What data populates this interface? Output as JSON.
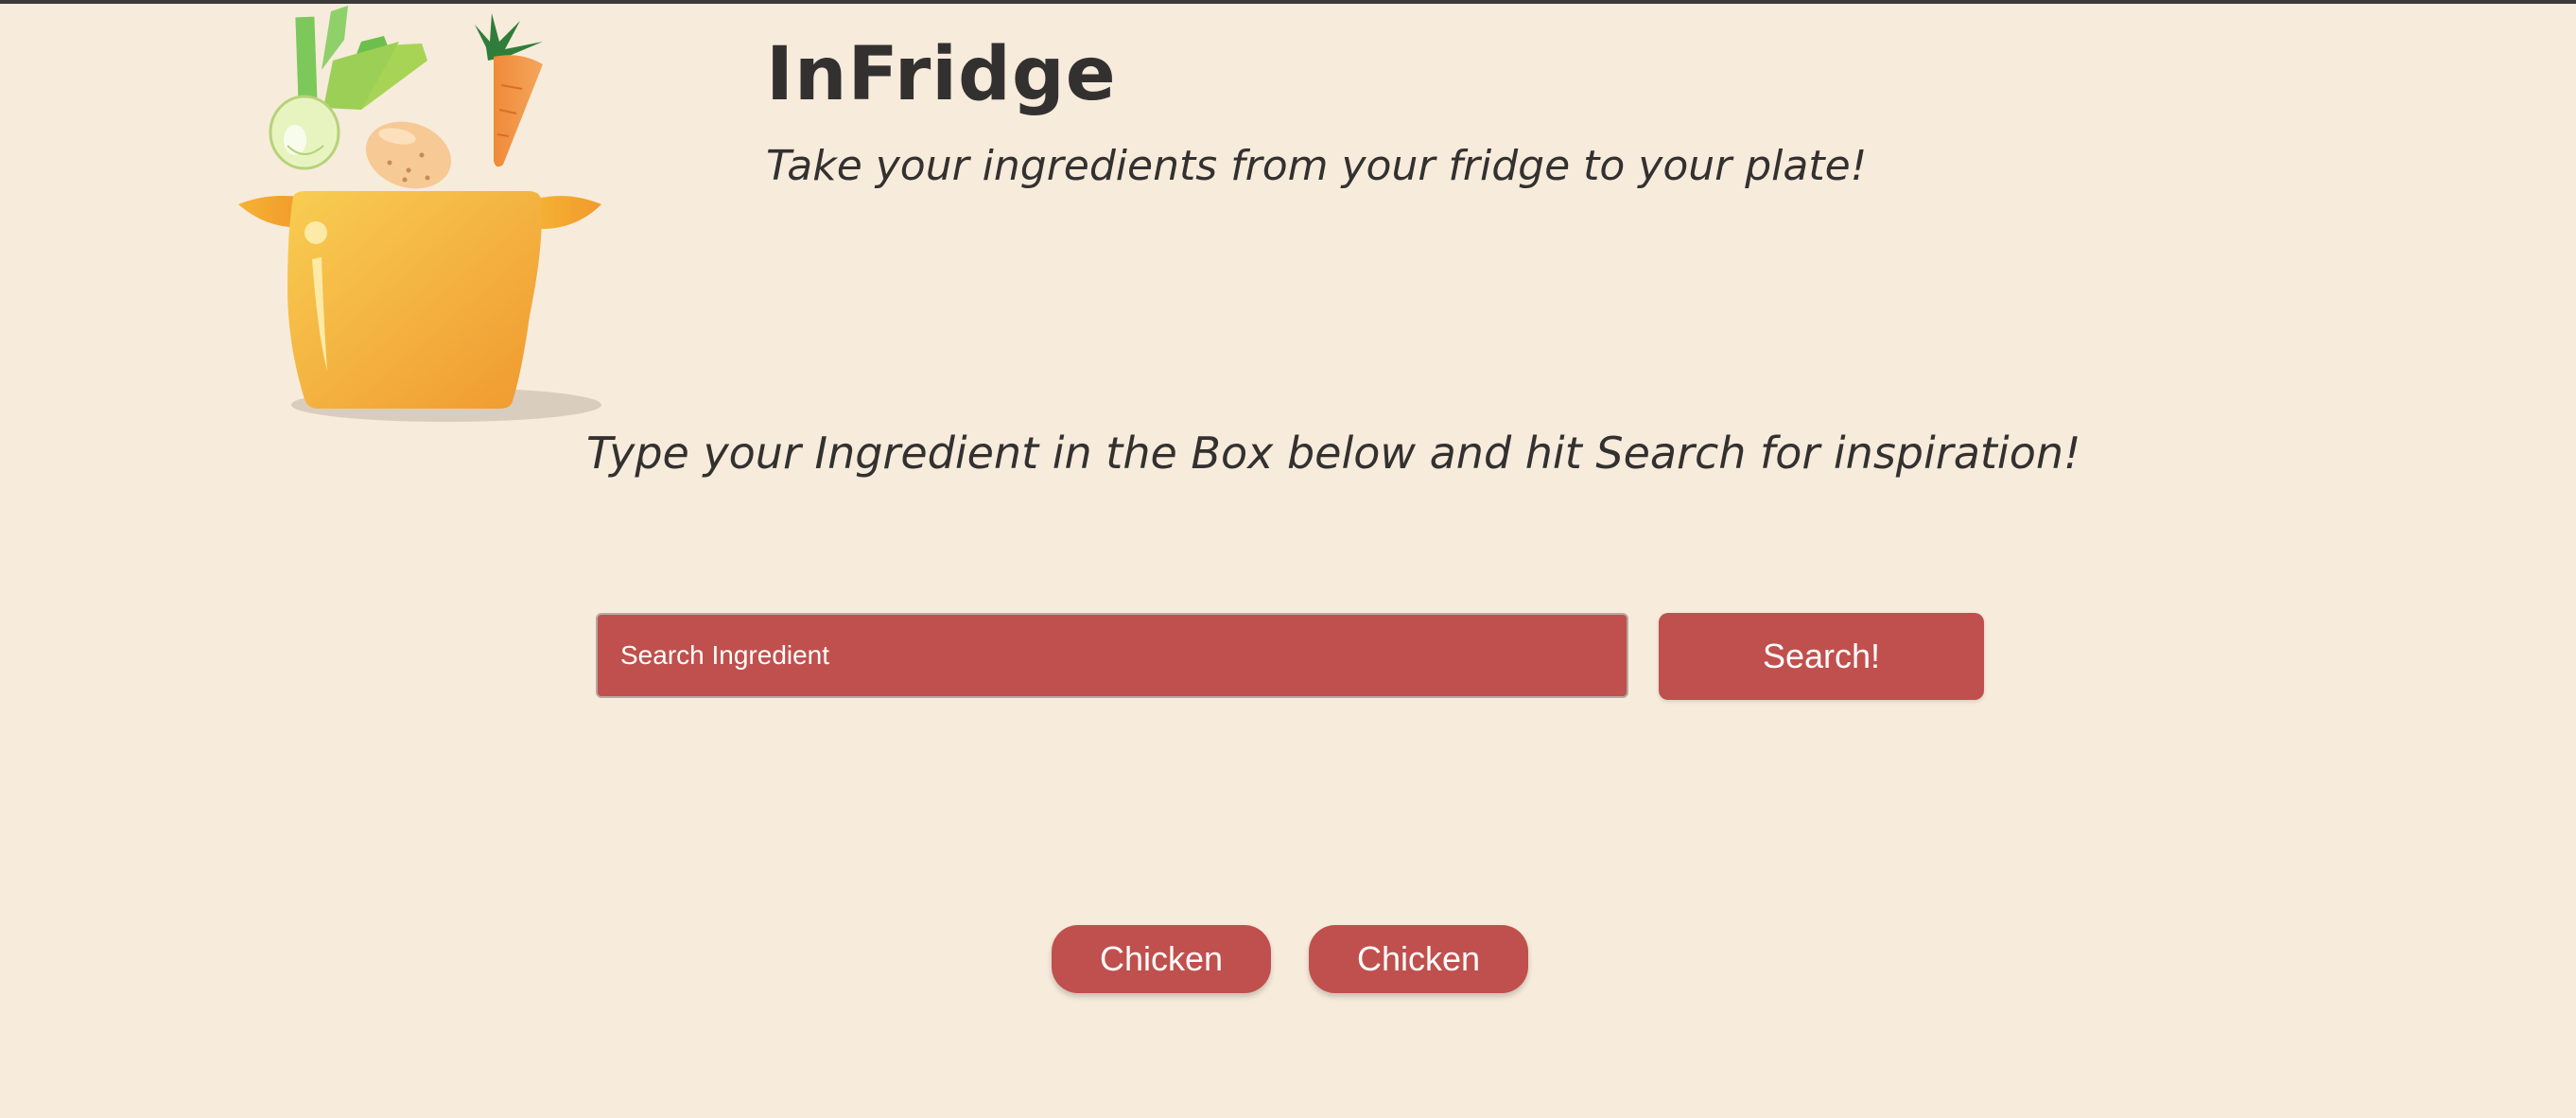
{
  "header": {
    "title": "InFridge",
    "tagline": "Take your ingredients from your fridge to your plate!"
  },
  "main": {
    "instructions": "Type your Ingredient in the Box below and hit Search for inspiration!",
    "search": {
      "placeholder": "Search Ingredient",
      "value": "",
      "button_label": "Search!"
    },
    "recent_searches": [
      {
        "label": "Chicken"
      },
      {
        "label": "Chicken"
      }
    ]
  },
  "theme": {
    "background": "#f7ebdb",
    "accent": "#c0504d",
    "text": "#333130"
  },
  "icons": {
    "logo": "cooking-pot-with-vegetables-icon"
  }
}
